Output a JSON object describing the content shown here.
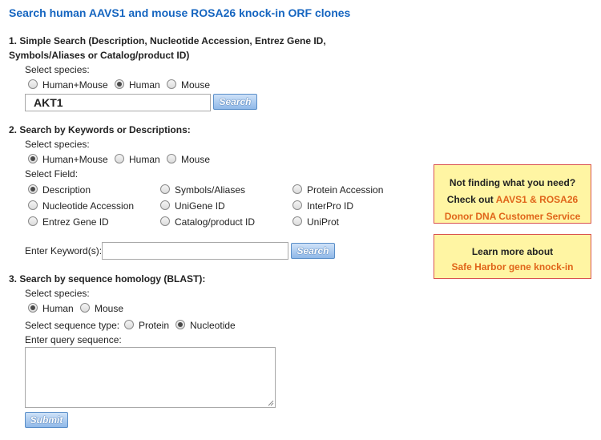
{
  "page_title": "Search human AAVS1 and mouse ROSA26 knock-in ORF clones",
  "section1": {
    "heading_line1": "1. Simple Search (Description, Nucleotide Accession, Entrez Gene ID,",
    "heading_line2": "Symbols/Aliases or Catalog/product ID)",
    "species_label": "Select species:",
    "species": [
      "Human+Mouse",
      "Human",
      "Mouse"
    ],
    "species_selected": "Human",
    "query_value": "AKT1",
    "search_button": "Search"
  },
  "section2": {
    "heading": "2. Search by Keywords or Descriptions:",
    "species_label": "Select species:",
    "species": [
      "Human+Mouse",
      "Human",
      "Mouse"
    ],
    "species_selected": "Human+Mouse",
    "field_label": "Select Field:",
    "fields": [
      "Description",
      "Symbols/Aliases",
      "Protein Accession",
      "Nucleotide Accession",
      "UniGene ID",
      "InterPro ID",
      "Entrez Gene ID",
      "Catalog/product ID",
      "UniProt"
    ],
    "field_selected": "Description",
    "keyword_label": "Enter Keyword(s):",
    "keyword_value": "",
    "search_button": "Search"
  },
  "section3": {
    "heading": "3. Search by sequence homology (BLAST):",
    "species_label": "Select species:",
    "species": [
      "Human",
      "Mouse"
    ],
    "species_selected": "Human",
    "seq_type_label": "Select sequence type:",
    "seq_types": [
      "Protein",
      "Nucleotide"
    ],
    "seq_type_selected": "Nucleotide",
    "query_label": "Enter query sequence:",
    "query_value": "",
    "submit_button": "Submit"
  },
  "sidebar": {
    "box1_line1": "Not finding what you need?",
    "box1_line2_prefix": "Check out ",
    "box1_link_part1": "AAVS1 & ROSA26",
    "box1_link_part2": "Donor DNA Customer Service",
    "box2_line1": "Learn more about",
    "box2_link": "Safe Harbor gene knock-in"
  },
  "colors": {
    "title": "#1565c0",
    "link": "#e0651a",
    "box_bg": "#fff5a3",
    "box_border": "#d9534f",
    "button": "#8fb8e8"
  }
}
